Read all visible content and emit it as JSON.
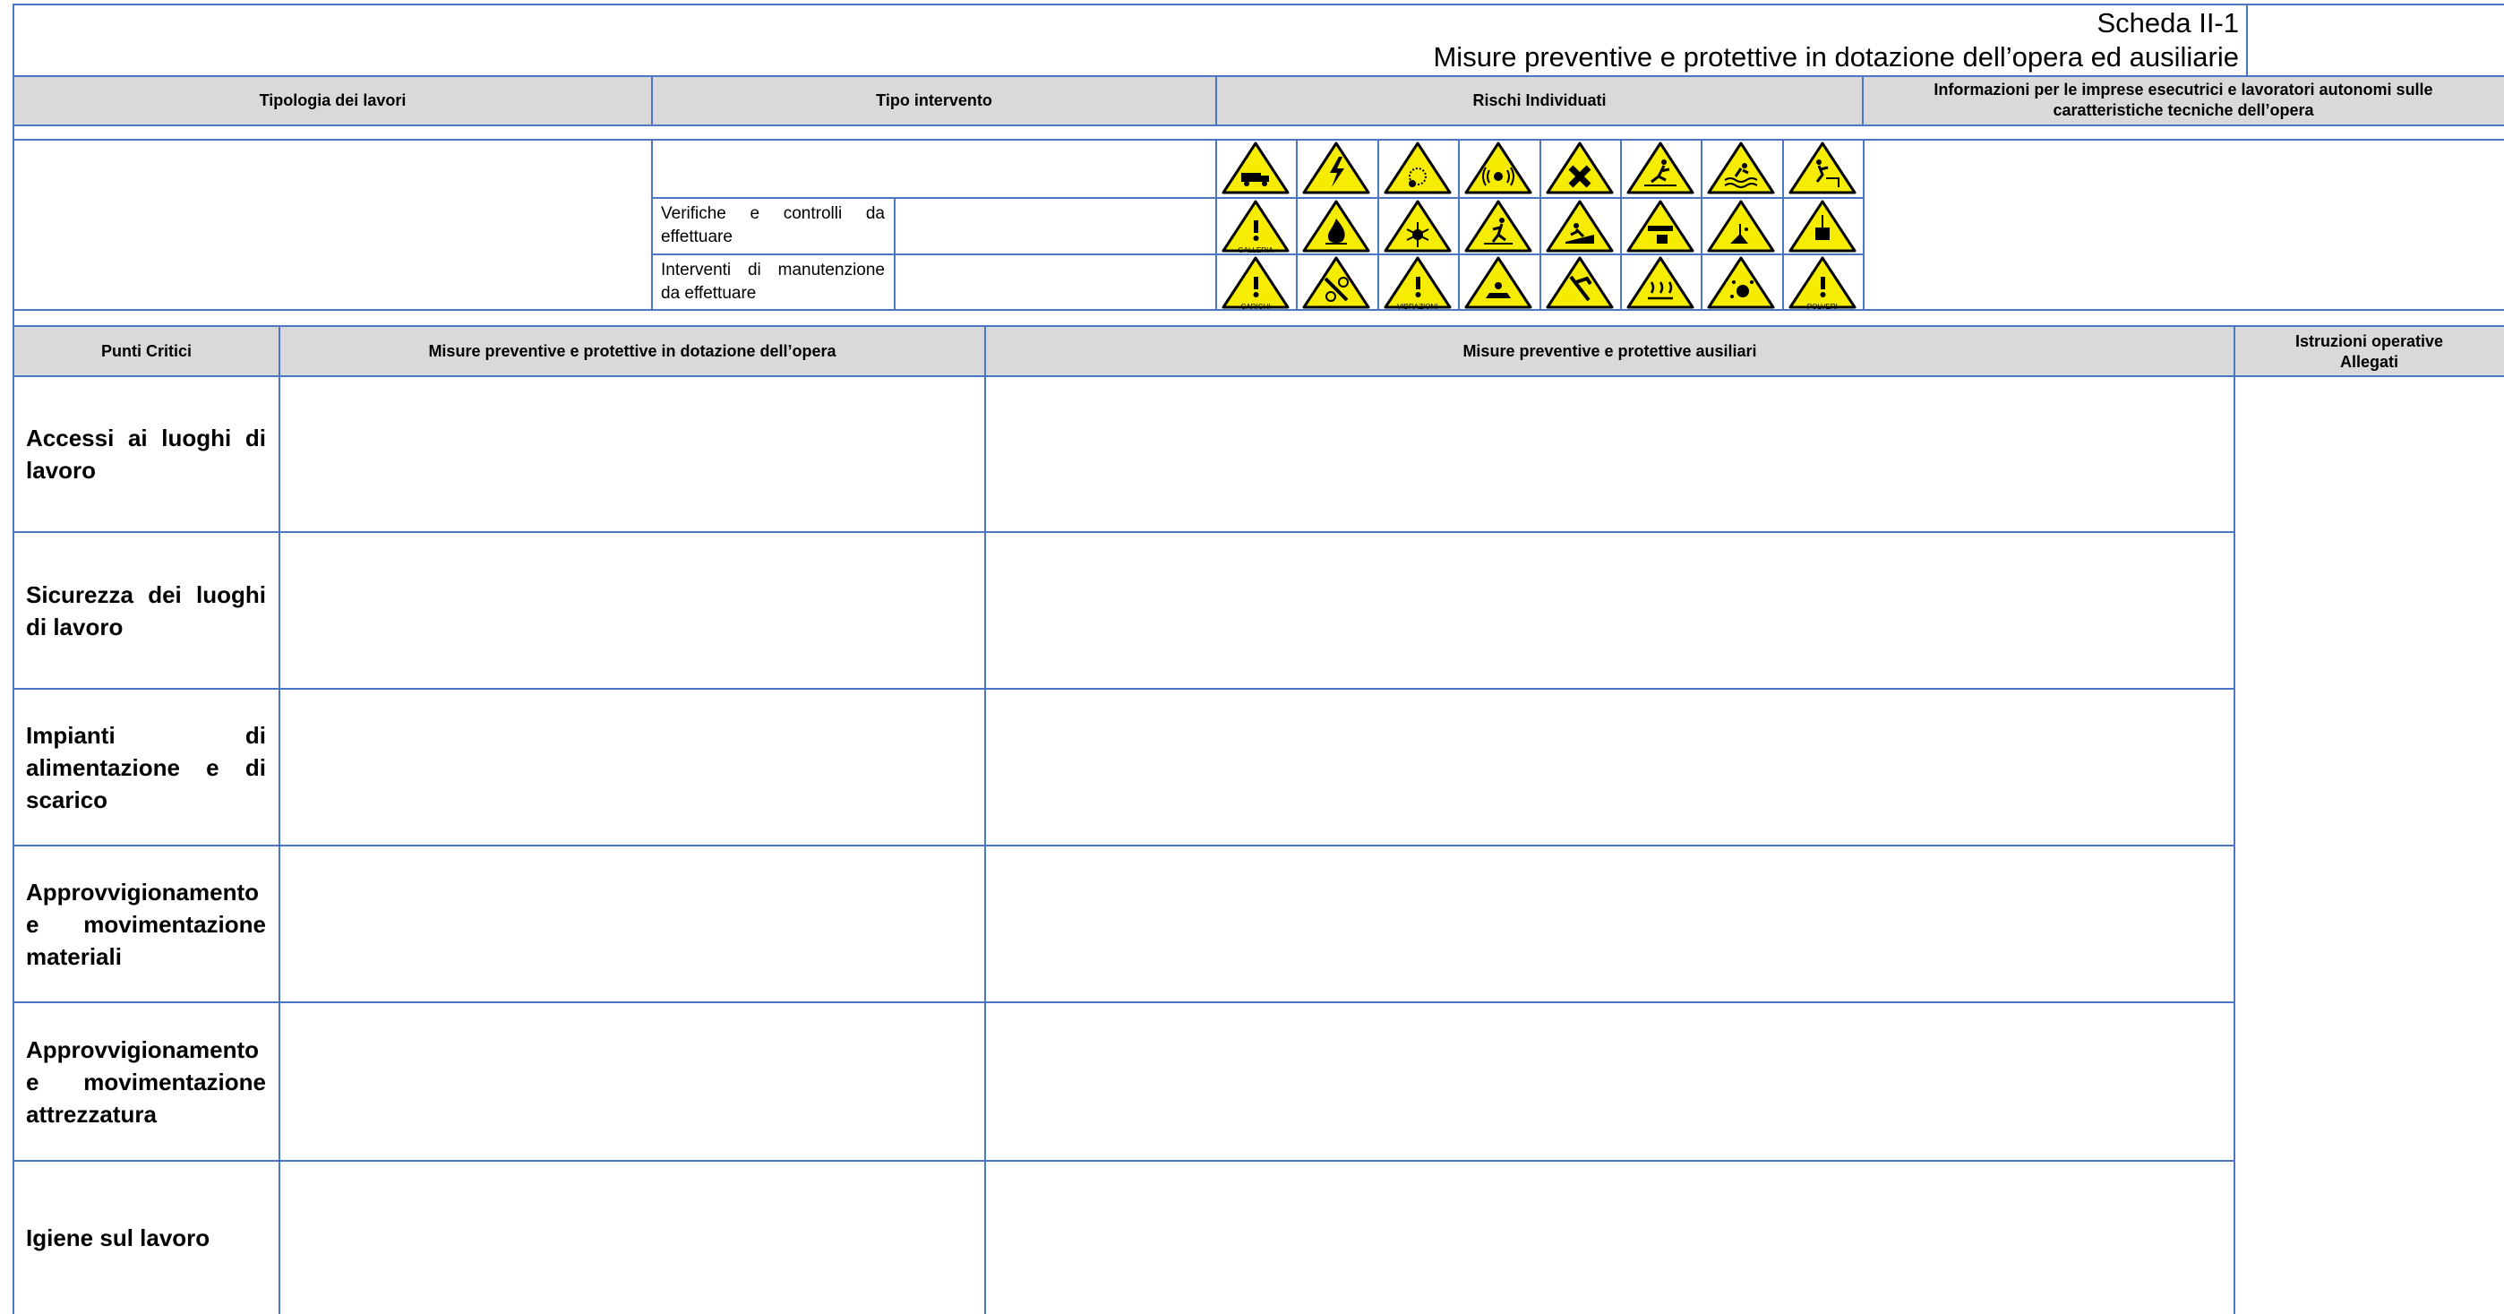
{
  "header": {
    "scheda": "Scheda II-1",
    "subtitle": "Misure preventive e protettive in dotazione dell’opera ed ausiliarie"
  },
  "columns_top": {
    "tipologia": "Tipologia dei lavori",
    "tipo_intervento": "Tipo intervento",
    "rischi": "Rischi Individuati",
    "informazioni_line1": "Informazioni per le imprese esecutrici e lavoratori autonomi sulle",
    "informazioni_line2": "caratteristiche tecniche dell’opera"
  },
  "interventi": {
    "verifiche": [
      "Verifiche e controlli da",
      "effettuare"
    ],
    "manutenzione": [
      "Interventi di manutenzione",
      "da effettuare"
    ]
  },
  "risk_icons": [
    {
      "icon": "truck-warning-icon",
      "caption": ""
    },
    {
      "icon": "electricity-warning-icon",
      "caption": ""
    },
    {
      "icon": "explosion-warning-icon",
      "caption": ""
    },
    {
      "icon": "noise-warning-icon",
      "caption": ""
    },
    {
      "icon": "harmful-cross-warning-icon",
      "caption": ""
    },
    {
      "icon": "slip-fall-warning-icon",
      "caption": ""
    },
    {
      "icon": "drowning-warning-icon",
      "caption": ""
    },
    {
      "icon": "fall-from-height-warning-icon",
      "caption": ""
    },
    {
      "icon": "tunnel-warning-icon",
      "caption": "GALLERIA"
    },
    {
      "icon": "fire-warning-icon",
      "caption": ""
    },
    {
      "icon": "biohazard-warning-icon",
      "caption": ""
    },
    {
      "icon": "trip-warning-icon",
      "caption": ""
    },
    {
      "icon": "burial-warning-icon",
      "caption": ""
    },
    {
      "icon": "crushing-warning-icon",
      "caption": ""
    },
    {
      "icon": "chemical-warning-icon",
      "caption": ""
    },
    {
      "icon": "suspended-load-warning-icon",
      "caption": ""
    },
    {
      "icon": "loads-warning-icon",
      "caption": "CARICHI"
    },
    {
      "icon": "machinery-warning-icon",
      "caption": ""
    },
    {
      "icon": "vibration-warning-icon",
      "caption": "VIBRAZIONI"
    },
    {
      "icon": "radiation-warning-icon",
      "caption": ""
    },
    {
      "icon": "cut-warning-icon",
      "caption": ""
    },
    {
      "icon": "hot-surface-warning-icon",
      "caption": ""
    },
    {
      "icon": "projection-warning-icon",
      "caption": ""
    },
    {
      "icon": "dust-warning-icon",
      "caption": "POLVERI"
    }
  ],
  "columns_bottom": {
    "punti_critici": "Punti Critici",
    "misure_dotazione": "Misure preventive e protettive in dotazione dell’opera",
    "misure_ausiliarie": "Misure preventive e protettive ausiliari",
    "istruzioni_line1": "Istruzioni operative",
    "istruzioni_line2": "Allegati"
  },
  "punti_critici": [
    {
      "lines": [
        "Accessi ai luoghi di",
        "lavoro"
      ]
    },
    {
      "lines": [
        "Sicurezza dei luoghi",
        "di lavoro"
      ]
    },
    {
      "lines": [
        "Impianti di",
        "alimentazione e di",
        "scarico"
      ]
    },
    {
      "lines": [
        "Approvvigionamento",
        "e movimentazione",
        "materiali"
      ]
    },
    {
      "lines": [
        "Approvvigionamento",
        "e movimentazione",
        "attrezzatura"
      ]
    },
    {
      "lines": [
        "Igiene sul lavoro"
      ]
    }
  ],
  "colors": {
    "border": "#4a76c4",
    "header_fill": "#d9d9d9",
    "sign_fill": "#f5ec00"
  }
}
